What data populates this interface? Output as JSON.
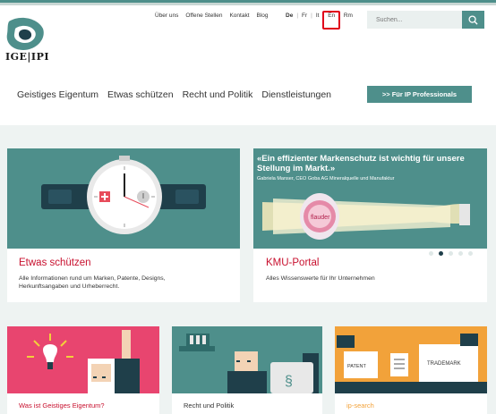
{
  "brand": {
    "logo_text": "IGE|IPI"
  },
  "utility_nav": [
    "Über uns",
    "Offene Stellen",
    "Kontakt",
    "Blog"
  ],
  "languages": [
    {
      "code": "De",
      "active": true
    },
    {
      "code": "Fr",
      "active": false
    },
    {
      "code": "It",
      "active": false
    },
    {
      "code": "En",
      "active": false,
      "highlighted": true
    },
    {
      "code": "Rm",
      "active": false
    }
  ],
  "search": {
    "placeholder": "Suchen..."
  },
  "main_nav": [
    "Geistiges Eigentum",
    "Etwas schützen",
    "Recht und Politik",
    "Dienstleistungen"
  ],
  "pro_button": ">> Für IP Professionals",
  "cards": [
    {
      "title": "Etwas schützen",
      "description": "Alle Informationen rund um Marken, Patente, Designs, Herkunftsangaben und Urheberrecht."
    },
    {
      "title": "KMU-Portal",
      "description": "Alles Wissenswerte für Ihr Unternehmen",
      "quote": "«Ein effizienter Markenschutz ist wichtig für unsere Stellung im Markt.»",
      "quote_author": "Gabriela Manser, CEO Goba AG Mineralquelle und Manufaktur",
      "bottle_label": "flauder",
      "carousel": {
        "count": 5,
        "active": 1
      }
    }
  ],
  "small_cards": [
    {
      "title": "Was ist Geistiges Eigentum?"
    },
    {
      "title": "Recht und Politik"
    },
    {
      "title": "ip-search",
      "patent_label": "PATENT",
      "trademark_label": "TRADEMARK"
    }
  ],
  "colors": {
    "teal": "#4e8f8b",
    "red": "#c8102e",
    "orange": "#f2a23a",
    "pink": "#e8456f"
  }
}
